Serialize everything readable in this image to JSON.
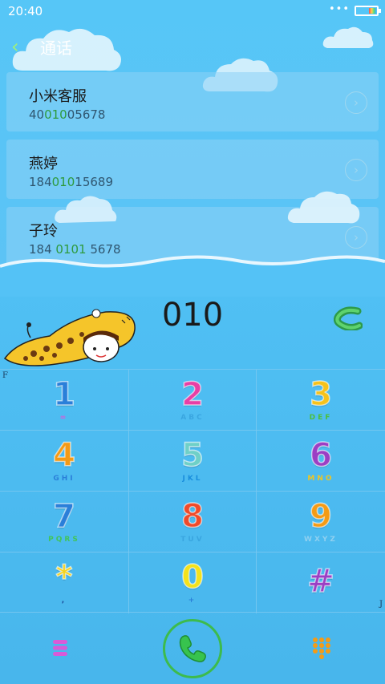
{
  "status_bar": {
    "time": "20:40",
    "dots": "•••"
  },
  "header": {
    "back_icon": "chevron-left-icon",
    "title": "通话"
  },
  "contacts": [
    {
      "name": "小米客服",
      "number_pre": "40",
      "number_match": "010",
      "number_post": "05678"
    },
    {
      "name": "燕婷",
      "number_pre": "184",
      "number_match": "010",
      "number_post": "15689"
    },
    {
      "name": "子玲",
      "number_pre": "184 ",
      "number_match": "0101",
      "number_post": " 5678"
    }
  ],
  "dialer": {
    "input": "010",
    "corner_left": "F",
    "corner_right": "J",
    "keys": [
      {
        "digit": "1",
        "letters": "∞",
        "color": "#2a7fd9",
        "letter_color": "#d85ad8"
      },
      {
        "digit": "2",
        "letters": "ABC",
        "color": "#e83fa5",
        "letter_color": "#3aa6e0"
      },
      {
        "digit": "3",
        "letters": "DEF",
        "color": "#f5c21c",
        "letter_color": "#4cbf3c"
      },
      {
        "digit": "4",
        "letters": "GHI",
        "color": "#f39a16",
        "letter_color": "#2a7fd9"
      },
      {
        "digit": "5",
        "letters": "JKL",
        "color": "#6fd0c8",
        "letter_color": "#1a8fdd"
      },
      {
        "digit": "6",
        "letters": "MNO",
        "color": "#9b3fc4",
        "letter_color": "#f0c51f"
      },
      {
        "digit": "7",
        "letters": "PQRS",
        "color": "#2a7fd9",
        "letter_color": "#42c45a"
      },
      {
        "digit": "8",
        "letters": "TUV",
        "color": "#ef4b2a",
        "letter_color": "#3aa6e0"
      },
      {
        "digit": "9",
        "letters": "WXYZ",
        "color": "#f49b16",
        "letter_color": "#8fd0f0"
      },
      {
        "digit": "*",
        "letters": ",",
        "color": "#f5d21c",
        "letter_color": "#1a4a9a"
      },
      {
        "digit": "0",
        "letters": "+",
        "color": "#f3e21c",
        "letter_color": "#2a7fd9"
      },
      {
        "digit": "#",
        "letters": "",
        "color": "#9b3fc4",
        "letter_color": "#9b3fc4"
      }
    ]
  },
  "bottom": {
    "menu_icon": "menu-icon",
    "call_icon": "phone-icon",
    "keypad_icon": "keypad-icon"
  }
}
